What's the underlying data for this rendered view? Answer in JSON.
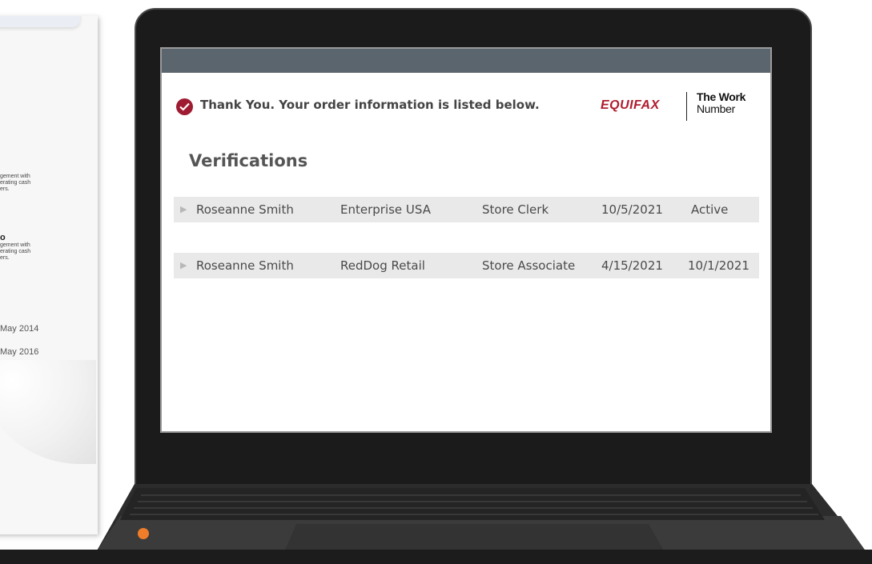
{
  "paper": {
    "block1": [
      "gement with",
      "erating cash",
      "ers."
    ],
    "block2_title": "o",
    "block2": [
      "gement with",
      "erating cash",
      "ers."
    ],
    "date1": "May 2014",
    "date2": "May 2016"
  },
  "confirmation": {
    "message": "Thank You. Your order information is listed below."
  },
  "logos": {
    "equifax": "EQUIFAX",
    "twn_line1": "The Work",
    "twn_line2": "Number"
  },
  "section_title": "Verifications",
  "verifications": [
    {
      "name": "Roseanne Smith",
      "employer": "Enterprise USA",
      "title": "Store Clerk",
      "start": "10/5/2021",
      "end": "Active"
    },
    {
      "name": "Roseanne Smith",
      "employer": "RedDog Retail",
      "title": "Store Associate",
      "start": "4/15/2021",
      "end": "10/1/2021"
    }
  ],
  "colors": {
    "brand_red": "#9e1b32",
    "header_bar": "#5b656d",
    "accent_orange": "#ef7d2a"
  },
  "icons": {
    "check": "check-circle-icon",
    "row_arrow": "triangle-right-icon",
    "marker": "orange-dot-icon"
  }
}
